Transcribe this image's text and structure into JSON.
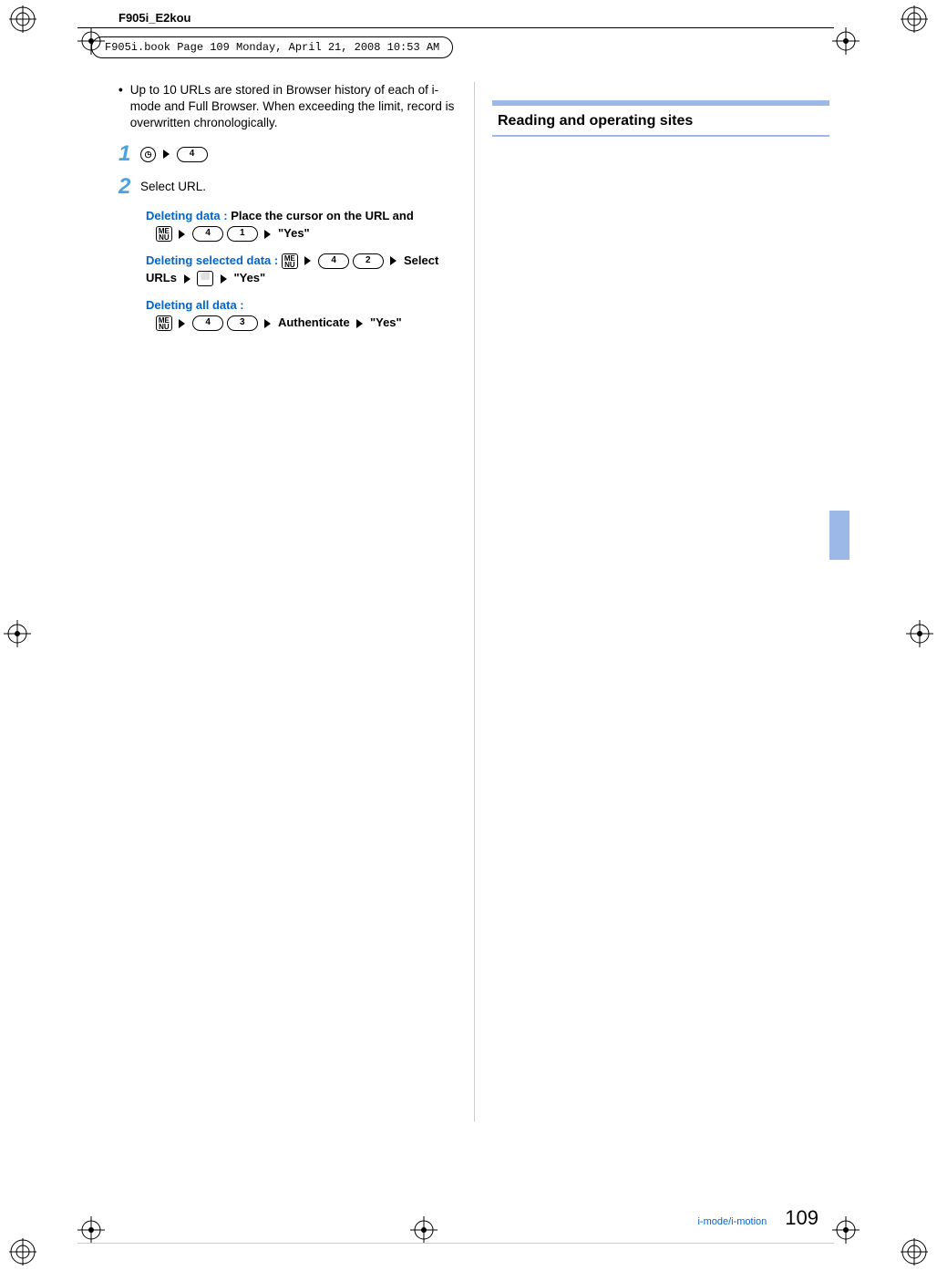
{
  "meta": {
    "doc_label": "F905i_E2kou",
    "print_header": "F905i.book  Page 109  Monday, April 21, 2008  10:53 AM"
  },
  "left": {
    "bullet": "Up to 10 URLs are stored in Browser history of each of i-mode and Full Browser. When exceeding the limit, record is overwritten chronologically.",
    "steps": {
      "s1": {
        "num": "1",
        "key_a": "4"
      },
      "s2": {
        "num": "2",
        "text": "Select URL."
      }
    },
    "del_data": {
      "label": "Deleting data :",
      "text": "Place the cursor on the URL and",
      "k1": "4",
      "k2": "1",
      "yes": "\"Yes\""
    },
    "del_sel": {
      "label": "Deleting selected data :",
      "k1": "4",
      "k2": "2",
      "sel": "Select URLs",
      "yes": "\"Yes\""
    },
    "del_all": {
      "label": "Deleting all data :",
      "k1": "4",
      "k2": "3",
      "auth": "Authenticate",
      "yes": "\"Yes\""
    }
  },
  "right": {
    "section_title": "Reading and operating sites"
  },
  "footer": {
    "section": "i-mode/i-motion",
    "page": "109"
  }
}
